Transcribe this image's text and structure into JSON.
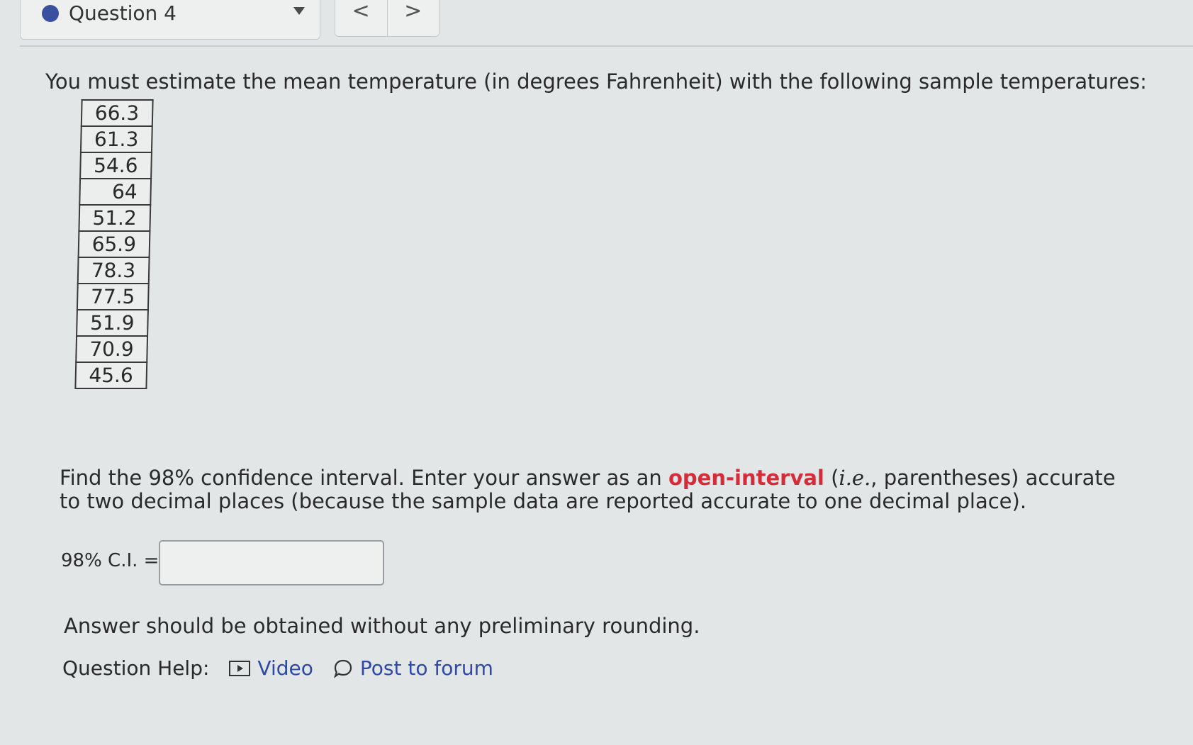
{
  "header": {
    "question_label": "Question 4",
    "status_color": "#3b4fa1",
    "prev_label": "<",
    "next_label": ">"
  },
  "question": {
    "prompt": "You must estimate the mean temperature (in degrees Fahrenheit) with the following sample temperatures:",
    "temperatures": [
      "66.3",
      "61.3",
      "54.6",
      "64",
      "51.2",
      "65.9",
      "78.3",
      "77.5",
      "51.9",
      "70.9",
      "45.6"
    ]
  },
  "instructions": {
    "part1": "Find the 98% confidence interval. Enter your answer as an ",
    "highlight": "open-interval",
    "part2": " (",
    "italic": "i.e.",
    "part3": ", parentheses) accurate to two decimal places (because the sample data are reported accurate to one decimal place)."
  },
  "answer": {
    "label": "98% C.I. =",
    "value": "",
    "placeholder": ""
  },
  "note": "Answer should be obtained without any preliminary rounding.",
  "help": {
    "label": "Question Help:",
    "video_label": "Video",
    "forum_label": "Post to forum"
  }
}
